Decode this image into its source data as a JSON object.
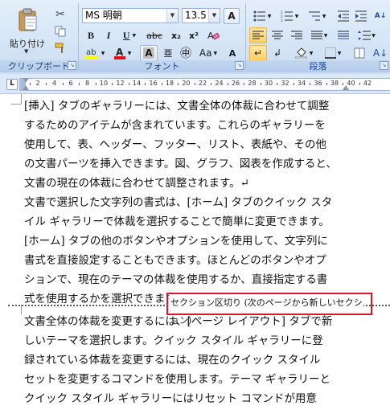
{
  "ribbon": {
    "clipboard": {
      "paste_label": "貼り付け",
      "group_label": "クリップボード"
    },
    "font": {
      "font_name": "MS 明朝",
      "font_size": "13.5",
      "group_label": "フォント",
      "buttons": {
        "bold": "B",
        "italic": "I",
        "underline": "U",
        "strike": "abc",
        "subscript": "x₂",
        "superscript": "x²",
        "grow": "A",
        "shrink": "A",
        "format_a": "A",
        "format_a2": "A",
        "aa": "Aa",
        "phonetic": "亜",
        "enclosed": "㊥"
      }
    },
    "paragraph": {
      "group_label": "段落"
    }
  },
  "ruler": {
    "tab_selector": "L",
    "numbers": [
      "2",
      "4",
      "6",
      "8",
      "10",
      "12",
      "14",
      "16",
      "18",
      "20",
      "22",
      "24",
      "26",
      "28",
      "30",
      "32",
      "34",
      "36",
      "38",
      "40",
      "42"
    ]
  },
  "document": {
    "section1_lines": [
      "[挿入] タブのギャラリーには、文書全体の体裁に合わせて調整",
      "するためのアイテムが含まれています。これらのギャラリーを",
      "使用して、表、ヘッダー、フッター、リスト、表紙や、その他",
      "の文書パーツを挿入できます。図、グラフ、図表を作成すると、",
      "文書の現在の体裁に合わせて調整されます。↵",
      "文書で選択した文字列の書式は、[ホーム] タブのクイック スタ",
      "イル ギャラリーで体裁を選択することで簡単に変更できます。",
      "[ホーム] タブの他のボタンやオプションを使用して、文字列に",
      "書式を直接設定することもできます。ほとんどのボタンやオプ",
      "ションで、現在のテーマの体裁を使用するか、直接指定する書",
      "式を使用するかを選択できます。"
    ],
    "section_break_label": "セクション区切り (次のページから新しいセクション)",
    "section2_lines": [
      "文書全体の体裁を変更するには、[ページ レイアウト] タブで新",
      "しいテーマを選択します。クイック スタイル ギャラリーに登",
      "録されている体裁を変更するには、現在のクイック スタイル",
      "セットを変更するコマンドを使用します。テーマ ギャラリーと",
      "クイック スタイル ギャラリーにはリセット コマンドが用意"
    ]
  },
  "colors": {
    "highlight_box": "#d6182a",
    "ribbon_bg": "#d6e6f7",
    "group_label_text": "#15428b"
  }
}
